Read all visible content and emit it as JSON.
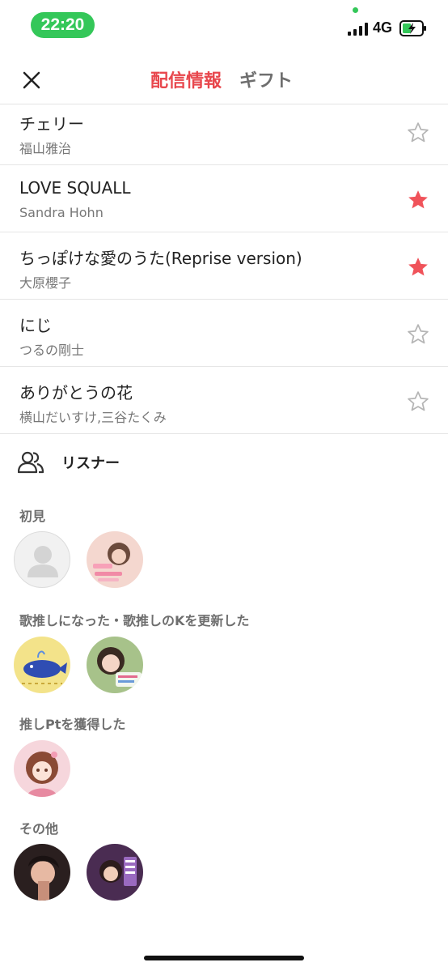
{
  "status": {
    "time": "22:20",
    "network": "4G"
  },
  "header": {
    "tabs": [
      {
        "label": "配信情報",
        "active": true
      },
      {
        "label": "ギフト",
        "active": false
      }
    ]
  },
  "songs": [
    {
      "title": "チェリー",
      "artist": "福山雅治",
      "favorited": false
    },
    {
      "title": "LOVE SQUALL",
      "artist": "Sandra Hohn",
      "favorited": true
    },
    {
      "title": "ちっぽけな愛のうた(Reprise version)",
      "artist": "大原櫻子",
      "favorited": true
    },
    {
      "title": "にじ",
      "artist": "つるの剛士",
      "favorited": false
    },
    {
      "title": "ありがとうの花",
      "artist": "横山だいすけ,三谷たくみ",
      "favorited": false
    }
  ],
  "listeners": {
    "title": "リスナー",
    "groups": [
      {
        "label": "初見",
        "avatars": [
          "default-avatar",
          "photo-avatar"
        ]
      },
      {
        "label": "歌推しになった・歌推しのKを更新した",
        "avatars": [
          "whale-avatar",
          "photo-avatar"
        ]
      },
      {
        "label": "推しPtを獲得した",
        "avatars": [
          "illustration-avatar"
        ]
      },
      {
        "label": "その他",
        "avatars": [
          "photo-avatar",
          "photo-avatar"
        ]
      }
    ]
  },
  "colors": {
    "accent": "#e8474d",
    "statusGreen": "#34c759",
    "starOn": "#f0535a",
    "starOff": "#b5b5b5"
  }
}
